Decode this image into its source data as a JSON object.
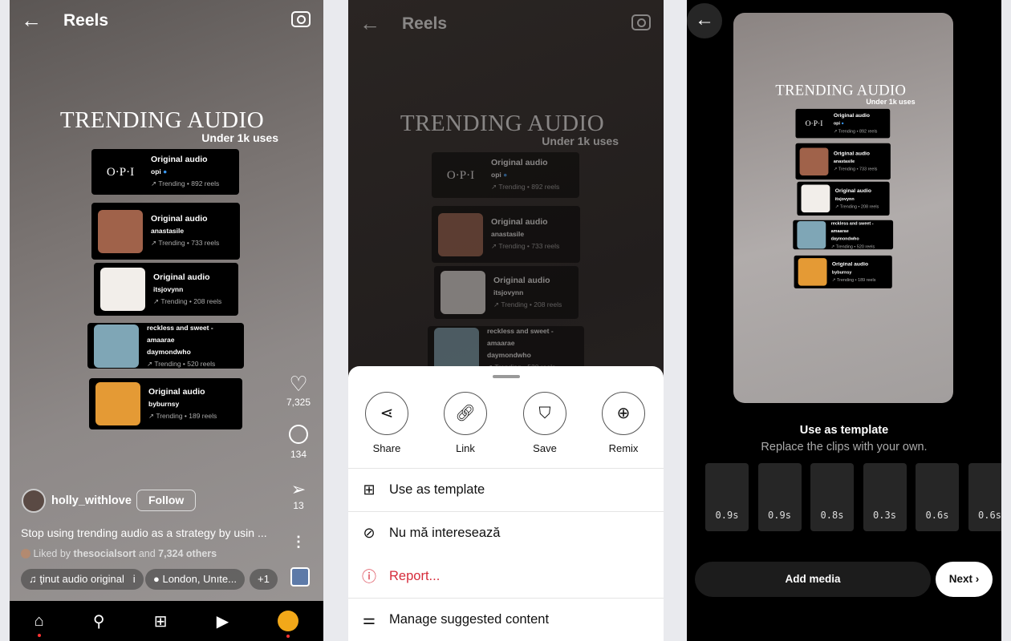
{
  "header": {
    "title": "Reels",
    "back_icon": "arrow-left-icon",
    "camera_icon": "camera-icon"
  },
  "overlay": {
    "title": "TRENDING AUDIO",
    "subtitle": "Under 1k uses",
    "audios": [
      {
        "name": "Original audio",
        "author": "opi",
        "verified": true,
        "thumb_text": "O·P·I",
        "stats": "↗ Trending • 892 reels",
        "thumb_color": "#000000"
      },
      {
        "name": "Original audio",
        "author": "anastasile",
        "stats": "↗ Trending • 733 reels",
        "thumb_color": "#a0624a"
      },
      {
        "name": "Original audio",
        "author": "itsjovynn",
        "stats": "↗ Trending • 208 reels",
        "thumb_color": "#f2eeea"
      },
      {
        "name": "reckless and sweet - amaarae",
        "author": "daymondwho",
        "stats": "↗ Trending • 520 reels",
        "thumb_color": "#7fa6b6"
      },
      {
        "name": "Original audio",
        "author": "byburnsy",
        "stats": "↗ Trending • 189 reels",
        "thumb_color": "#e49a35"
      }
    ]
  },
  "reel": {
    "username": "holly_withlove",
    "follow": "Follow",
    "caption": "Stop using trending audio as a strategy by usin ...",
    "liked_prefix": "Liked by",
    "liked_user": "thesocialsort",
    "liked_and": "and",
    "liked_others": "7,324 others",
    "audio_pill": "ţinut audio original",
    "audio_pill_suffix": "i",
    "location": "London, Unıte...",
    "more": "+1",
    "likes": "7,325",
    "comments": "134",
    "shares": "13"
  },
  "sheet": {
    "actions": [
      {
        "label": "Share",
        "icon": "share-icon"
      },
      {
        "label": "Link",
        "icon": "link-icon"
      },
      {
        "label": "Save",
        "icon": "bookmark-icon"
      },
      {
        "label": "Remix",
        "icon": "remix-icon"
      }
    ],
    "items": [
      {
        "label": "Use as template",
        "icon": "plus-square-icon"
      },
      {
        "label": "Nu mă interesează",
        "icon": "eye-off-icon"
      },
      {
        "label": "Report...",
        "icon": "report-icon",
        "color": "#d62c3b"
      },
      {
        "label": "Manage suggested content",
        "icon": "sliders-icon"
      }
    ]
  },
  "template": {
    "title": "Use as template",
    "subtitle": "Replace the clips with your own.",
    "clips": [
      "0.9s",
      "0.9s",
      "0.8s",
      "0.3s",
      "0.6s",
      "0.6s"
    ],
    "add_media": "Add media",
    "next": "Next"
  }
}
